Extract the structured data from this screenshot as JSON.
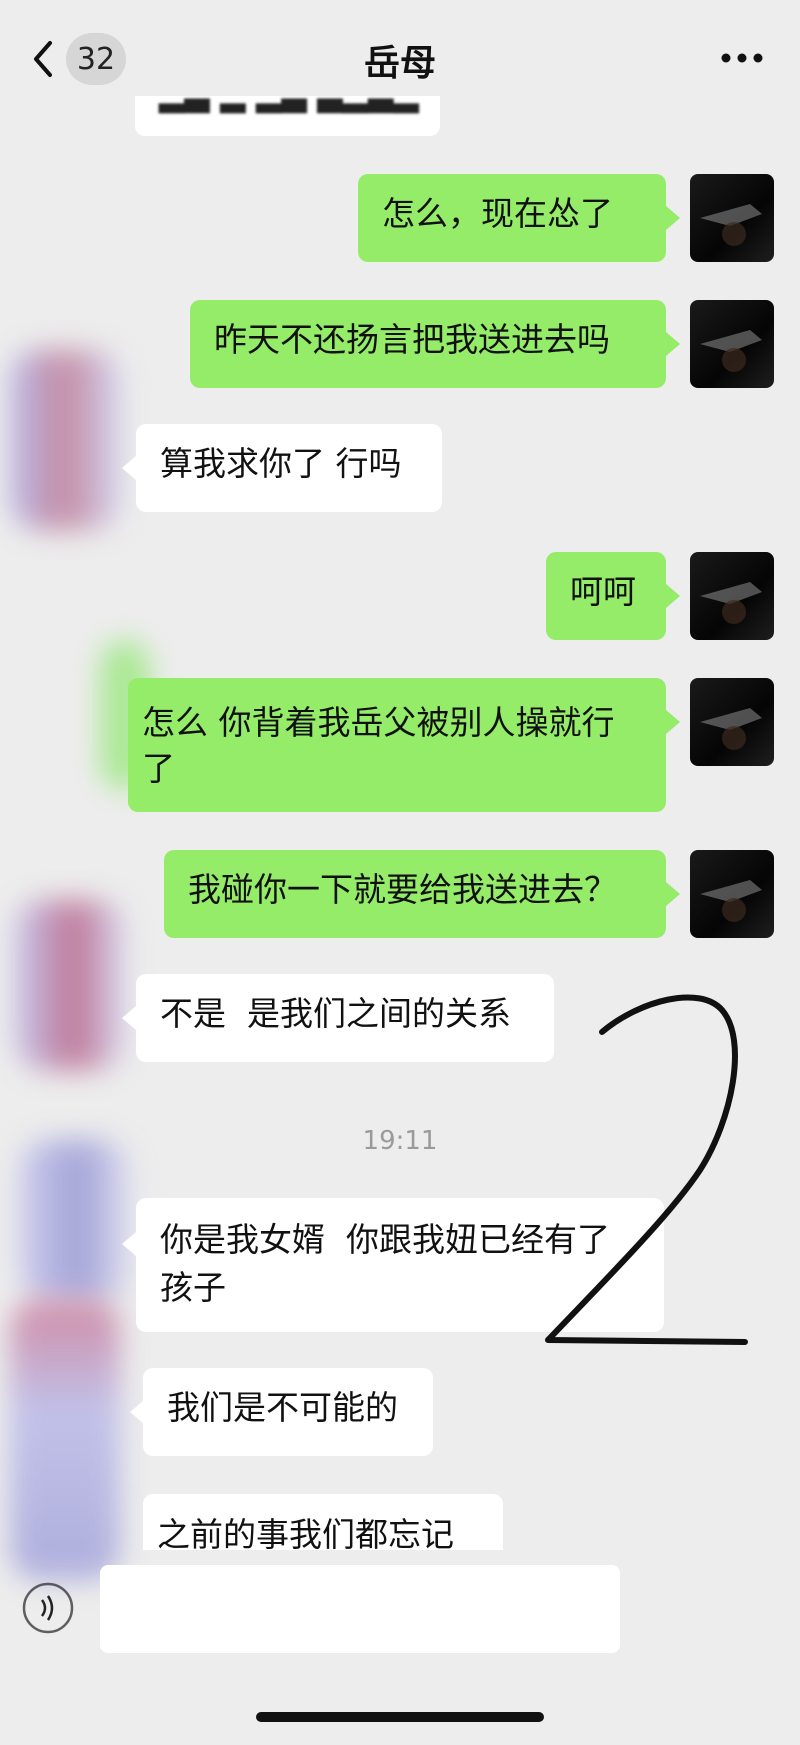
{
  "header": {
    "back_icon": "chevron-left-icon",
    "unread_count": "32",
    "title": "岳母",
    "more_icon": "ellipsis-icon"
  },
  "messages": [
    {
      "side": "right",
      "text": "怎么，现在怂了"
    },
    {
      "side": "right",
      "text": "昨天不还扬言把我送进去吗"
    },
    {
      "side": "left",
      "text": "算我求你了 行吗"
    },
    {
      "side": "right",
      "text": "呵呵"
    },
    {
      "side": "right",
      "text": "怎么 你背着我岳父被别人操就行了"
    },
    {
      "side": "right",
      "text": "我碰你一下就要给我送进去？"
    },
    {
      "side": "left",
      "text": "不是  是我们之间的关系"
    },
    {
      "side": "left",
      "text": "你是我女婿  你跟我妞已经有了孩子"
    },
    {
      "side": "left",
      "text": "我们是不可能的"
    },
    {
      "side": "left",
      "text": "之前的事我们都忘记"
    }
  ],
  "timestamp": "19:11",
  "annotation_mark": "2",
  "colors": {
    "background": "#ededed",
    "self_bubble": "#95ec69",
    "other_bubble": "#ffffff",
    "timestamp": "#9a9a9a"
  }
}
